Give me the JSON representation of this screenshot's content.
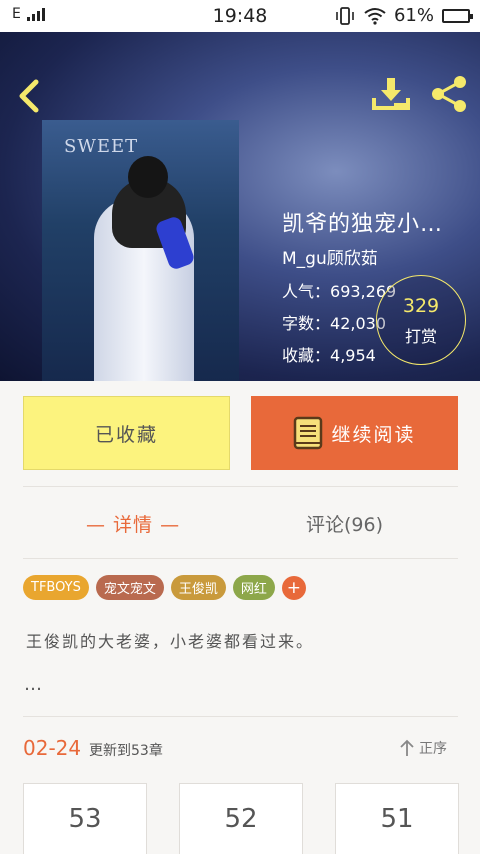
{
  "status_bar": {
    "network": "E",
    "time": "19:48",
    "battery": "61%"
  },
  "hero": {
    "cover_text": "SWEET",
    "title": "凯爷的独宠小…",
    "author": "M_gu顾欣茹",
    "popularity_label": "人气：",
    "popularity": "693,269",
    "words_label": "字数：",
    "words": "42,030",
    "favorites_label": "收藏：",
    "favorites": "4,954",
    "reward_count": "329",
    "reward_label": "打赏"
  },
  "actions": {
    "favorited_label": "已收藏",
    "continue_label": "继续阅读"
  },
  "tabs": {
    "detail_label": "— 详情 —",
    "comments_label": "评论(96)"
  },
  "tags": [
    {
      "label": "TFBOYS",
      "color": "#e9a62f"
    },
    {
      "label": "宠文宠文",
      "color": "#b96a4f"
    },
    {
      "label": "王俊凯",
      "color": "#c99a3c"
    },
    {
      "label": "网红",
      "color": "#8da74a"
    }
  ],
  "tag_add_label": "+",
  "description": "王俊凯的大老婆，小老婆都看过来。",
  "description_more": "…",
  "update": {
    "date": "02-24",
    "text": "更新到53章",
    "sort_label": "正序"
  },
  "chapters": [
    "53",
    "52",
    "51"
  ],
  "colors": {
    "accent": "#e8693a",
    "favorite_button": "#fcf37e",
    "icon_yellow": "#f5e96b"
  }
}
